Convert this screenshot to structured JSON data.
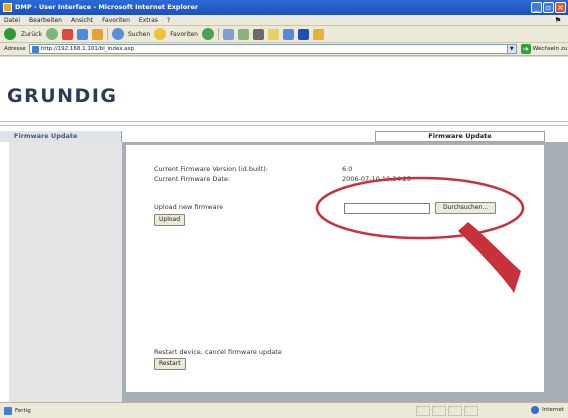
{
  "window": {
    "title": "DMP - User Interface - Microsoft Internet Explorer",
    "buttons": [
      "_",
      "▫",
      "×"
    ]
  },
  "menu": [
    "Datei",
    "Bearbeiten",
    "Ansicht",
    "Favoriten",
    "Extras",
    "?"
  ],
  "toolbar": {
    "back_label": "Zurück",
    "search_label": "Suchen",
    "favorites_label": "Favoriten"
  },
  "address": {
    "label": "Adresse",
    "url": "http://192.168.1.101/bl_index.asp",
    "go_label": "Wechseln zu"
  },
  "page": {
    "logo": "GRUNDIG",
    "left_tab": "Firmware Update",
    "right_tab": "Firmware Update",
    "fw_version_label": "Current Firmware Version (id.built):",
    "fw_version_value": "6.0",
    "fw_date_label": "Current Firmware Date:",
    "fw_date_value": "2006-07-10  10:34:25",
    "upload_label": "Upload new firmware",
    "browse_button": "Durchsuchen...",
    "upload_button": "Upload",
    "restart_label": "Restart device, cancel firmware update",
    "restart_button": "Restart"
  },
  "status": {
    "left": "Fertig",
    "zone": "Internet"
  },
  "colors": {
    "titlebar": "#1d50b9",
    "logo": "#2d3a5a",
    "annotation": "#c8303a"
  }
}
